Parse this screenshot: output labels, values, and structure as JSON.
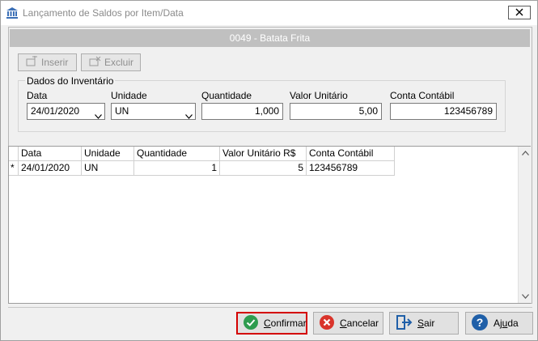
{
  "window": {
    "title": "Lançamento de Saldos por Item/Data",
    "icon": "bank-icon",
    "close_icon": "close-icon"
  },
  "header": {
    "product": "0049 - Batata Frita"
  },
  "toolbar": {
    "insert_label": "Inserir",
    "delete_label": "Excluir"
  },
  "inventory": {
    "legend": "Dados do Inventário",
    "date_label": "Data",
    "date_value": "24/01/2020",
    "unit_label": "Unidade",
    "unit_value": "UN",
    "quantity_label": "Quantidade",
    "quantity_value": "1,000",
    "unit_price_label": "Valor Unitário",
    "unit_price_value": "5,00",
    "account_label": "Conta Contábil",
    "account_value": "123456789"
  },
  "grid": {
    "columns": [
      "Data",
      "Unidade",
      "Quantidade",
      "Valor Unitário R$",
      "Conta Contábil"
    ],
    "rows": [
      {
        "marker": "*",
        "date": "24/01/2020",
        "unit": "UN",
        "quantity": "1",
        "unit_price": "5",
        "account": "123456789"
      }
    ]
  },
  "buttons": {
    "confirm_first": "C",
    "confirm_rest": "onfirmar",
    "cancel_first": "C",
    "cancel_rest": "ancelar",
    "exit_first": "S",
    "exit_rest": "air",
    "help_pre": "Aj",
    "help_under": "u",
    "help_rest": "da"
  },
  "colors": {
    "confirm_icon": "#2e9c4f",
    "cancel_icon": "#d9342b",
    "exit_icon": "#1f5fa8",
    "help_icon": "#1f5fa8",
    "focus_border": "#d40000",
    "header_bar": "#c0c0c0"
  }
}
